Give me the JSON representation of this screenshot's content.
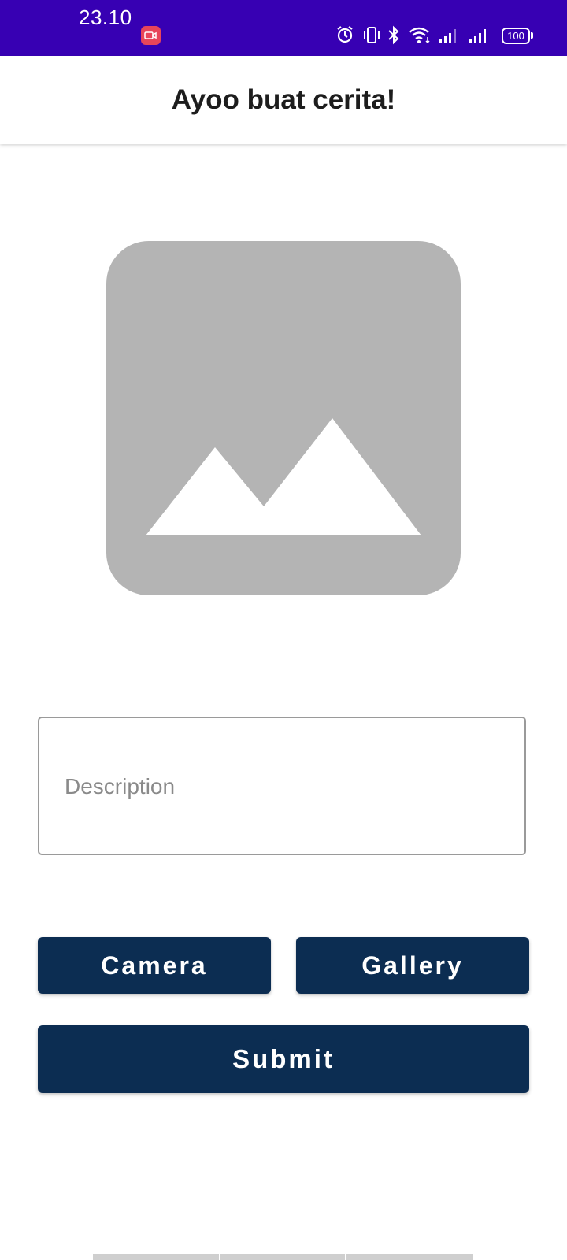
{
  "status_bar": {
    "time": "23.10",
    "battery": "100",
    "background": "#3700b3",
    "icons": [
      "screen-record-icon",
      "alarm-icon",
      "vibrate-icon",
      "bluetooth-icon",
      "wifi-icon",
      "signal-icon",
      "signal-icon",
      "battery-icon"
    ]
  },
  "app_bar": {
    "title": "Ayoo buat cerita!"
  },
  "image_preview": {
    "icon": "image-placeholder-icon",
    "color": "#b4b4b4"
  },
  "description": {
    "placeholder": "Description",
    "value": ""
  },
  "buttons": {
    "camera": "Camera",
    "gallery": "Gallery",
    "submit": "Submit",
    "color": "#0c2d52"
  }
}
